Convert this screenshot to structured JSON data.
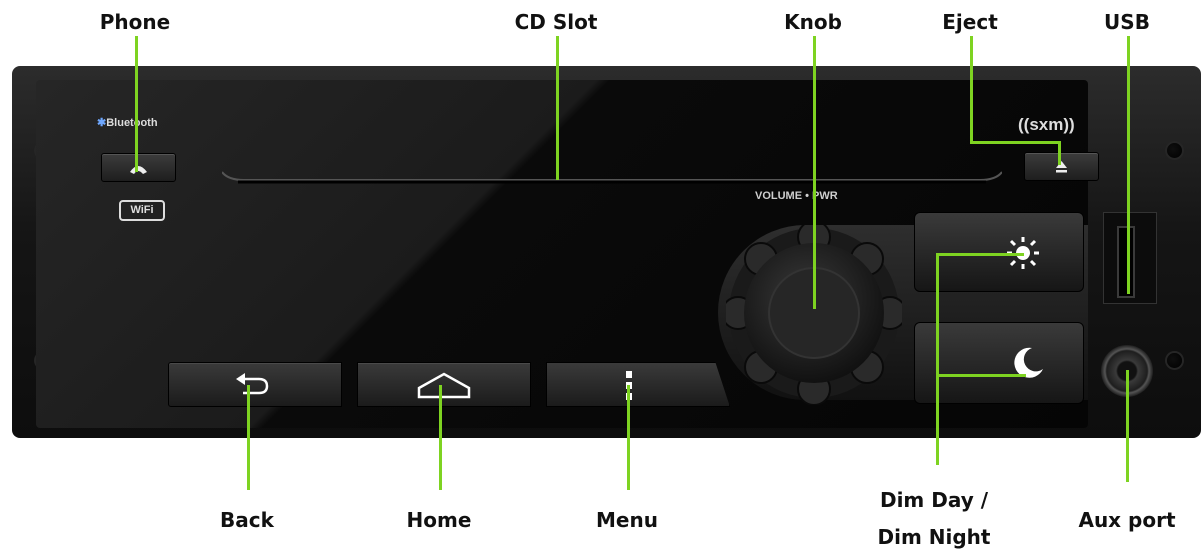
{
  "callouts": {
    "phone": "Phone",
    "cd_slot": "CD Slot",
    "knob": "Knob",
    "eject": "Eject",
    "usb": "USB",
    "back": "Back",
    "home": "Home",
    "menu": "Menu",
    "dim_line1": "Dim Day /",
    "dim_line2": "Dim Night",
    "aux_port": "Aux port"
  },
  "device": {
    "bluetooth": "Bluetooth",
    "wifi": "WiFi",
    "sxm": "((sxm))",
    "volume_pwr": "VOLUME • PWR"
  },
  "icons": {
    "phone": "phone-icon",
    "eject": "eject-icon",
    "back": "back-arrow-icon",
    "home": "home-icon",
    "menu": "menu-dots-icon",
    "sun": "sun-icon",
    "moon": "moon-icon",
    "bluetooth": "bluetooth-icon"
  },
  "colors": {
    "leader": "#7ed321",
    "body": "#111111"
  }
}
